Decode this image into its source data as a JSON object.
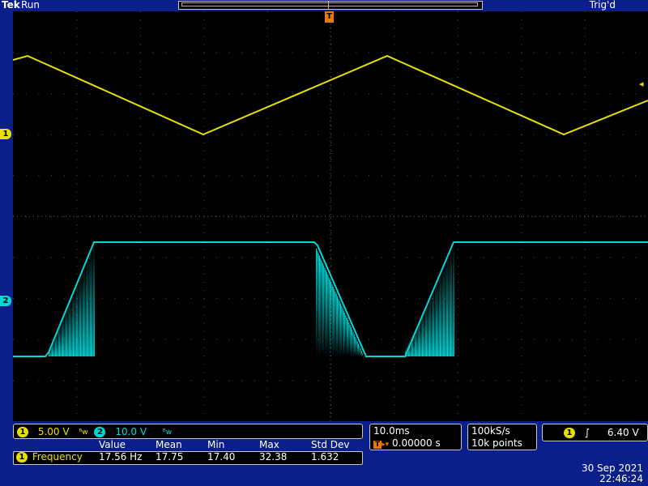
{
  "header": {
    "brand": "Tek",
    "run_state": "Run",
    "trigger_state": "Trig'd"
  },
  "markers": {
    "ch1": "1",
    "ch2": "2",
    "trigger": "T",
    "trigger_level_icon": "arrow-left-icon"
  },
  "scales": {
    "ch1_label": "1",
    "ch1_scale": "5.00 V",
    "ch2_label": "2",
    "ch2_scale": "10.0 V",
    "bandwidth_icon": "bw-limit-icon"
  },
  "timebase": {
    "time_per_div": "10.0ms",
    "trigger_position": "0.00000 s"
  },
  "acquisition": {
    "sample_rate": "100kS/s",
    "record_length": "10k points"
  },
  "trigger": {
    "source": "1",
    "slope_icon": "rising-edge-icon",
    "level": "6.40 V"
  },
  "measurement": {
    "headers": [
      "Value",
      "Mean",
      "Min",
      "Max",
      "Std Dev"
    ],
    "source": "1",
    "name": "Frequency",
    "values": [
      "17.56 Hz",
      "17.75",
      "17.40",
      "32.38",
      "1.632"
    ]
  },
  "datetime": {
    "date": "30 Sep  2021",
    "time": "22:46:24"
  },
  "colors": {
    "background": "#0a1f8a",
    "screen": "#000000",
    "ch1": "#e8e000",
    "ch2": "#00d8d8",
    "trigger": "#e87800"
  }
}
